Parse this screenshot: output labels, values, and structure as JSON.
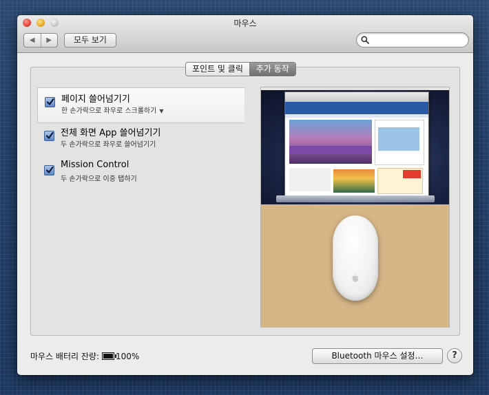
{
  "window": {
    "title": "마우스",
    "show_all_label": "모두 보기",
    "back_icon": "chevron-left-icon",
    "forward_icon": "chevron-right-icon",
    "search": {
      "value": "",
      "placeholder": "",
      "icon": "search-icon"
    }
  },
  "tabs": [
    {
      "label": "포인트 및 클릭",
      "active": false
    },
    {
      "label": "추가 동작",
      "active": true
    }
  ],
  "gestures": [
    {
      "title": "페이지 쓸어넘기기",
      "subtitle": "한 손가락으로 좌우로 스크롤하기",
      "checked": true,
      "selected": true,
      "has_dropdown": true
    },
    {
      "title": "전체 화면 App 쓸어넘기기",
      "subtitle": "두 손가락으로 좌우로 쓸어넘기기",
      "checked": true,
      "selected": false,
      "has_dropdown": false
    },
    {
      "title": "Mission Control",
      "subtitle": "두 손가락으로 이중 탭하기",
      "checked": true,
      "selected": false,
      "has_dropdown": false
    }
  ],
  "footer": {
    "battery_label": "마우스 배터리 잔량:",
    "battery_value": "100%",
    "bluetooth_button": "Bluetooth 마우스 설정…",
    "help_label": "?"
  },
  "colors": {
    "checkbox": "#5d86c8",
    "active_tab": "#6f6f6f",
    "desktop_bg": "#14173a"
  }
}
